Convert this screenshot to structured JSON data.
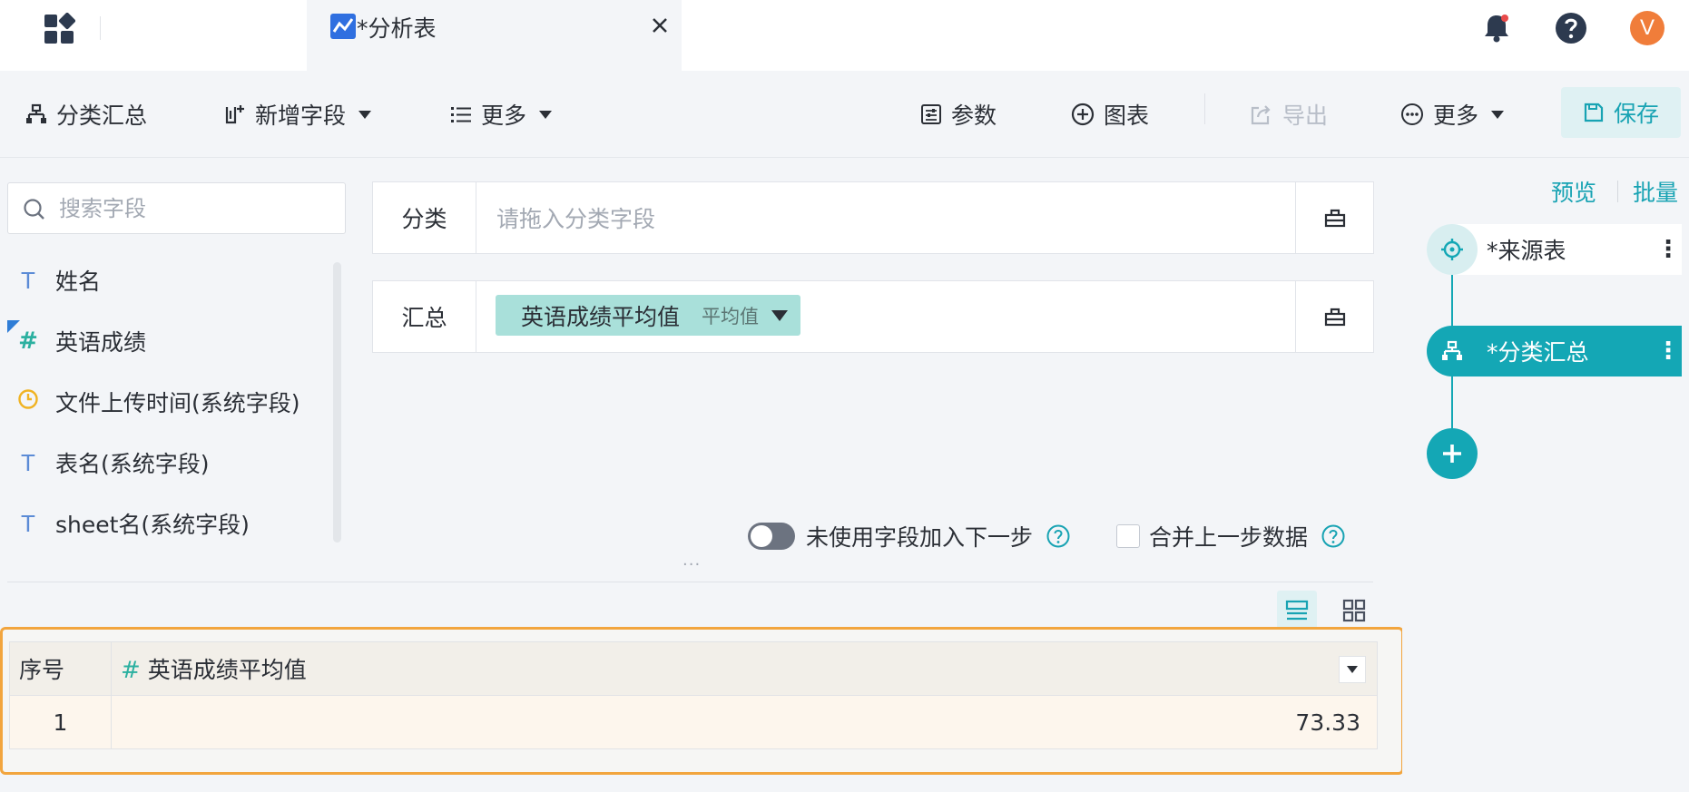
{
  "tabs": {
    "active_label": "*分析表"
  },
  "user": {
    "avatar_initial": "V"
  },
  "toolbar": {
    "category_summary": "分类汇总",
    "add_field": "新增字段",
    "more_left": "更多",
    "params": "参数",
    "chart": "图表",
    "export": "导出",
    "more_right": "更多",
    "save": "保存"
  },
  "field_list": {
    "search_placeholder": "搜索字段",
    "fields": [
      {
        "name": "姓名",
        "type": "text"
      },
      {
        "name": "英语成绩",
        "type": "number"
      },
      {
        "name": "文件上传时间(系统字段)",
        "type": "datetime"
      },
      {
        "name": "表名(系统字段)",
        "type": "text"
      },
      {
        "name": "sheet名(系统字段)",
        "type": "text"
      }
    ]
  },
  "config": {
    "category_label": "分类",
    "category_placeholder": "请拖入分类字段",
    "summary_label": "汇总",
    "summary_chip": {
      "field": "英语成绩平均值",
      "agg": "平均值"
    },
    "unused_fields_toggle": {
      "label": "未使用字段加入下一步",
      "on": false
    },
    "merge_prev_checkbox": {
      "label": "合并上一步数据",
      "checked": false
    },
    "splitter": "···"
  },
  "result_table": {
    "columns": [
      "序号",
      "英语成绩平均值"
    ],
    "rows": [
      {
        "seq": "1",
        "value": "73.33"
      }
    ]
  },
  "flow": {
    "preview": "预览",
    "batch": "批量",
    "nodes": [
      {
        "label": "*来源表"
      },
      {
        "label": "*分类汇总"
      }
    ]
  },
  "colors": {
    "accent": "#14a7b5",
    "highlight_border": "#f2a53e",
    "chip_bg": "#a9e0da",
    "avatar": "#f07d3a"
  }
}
